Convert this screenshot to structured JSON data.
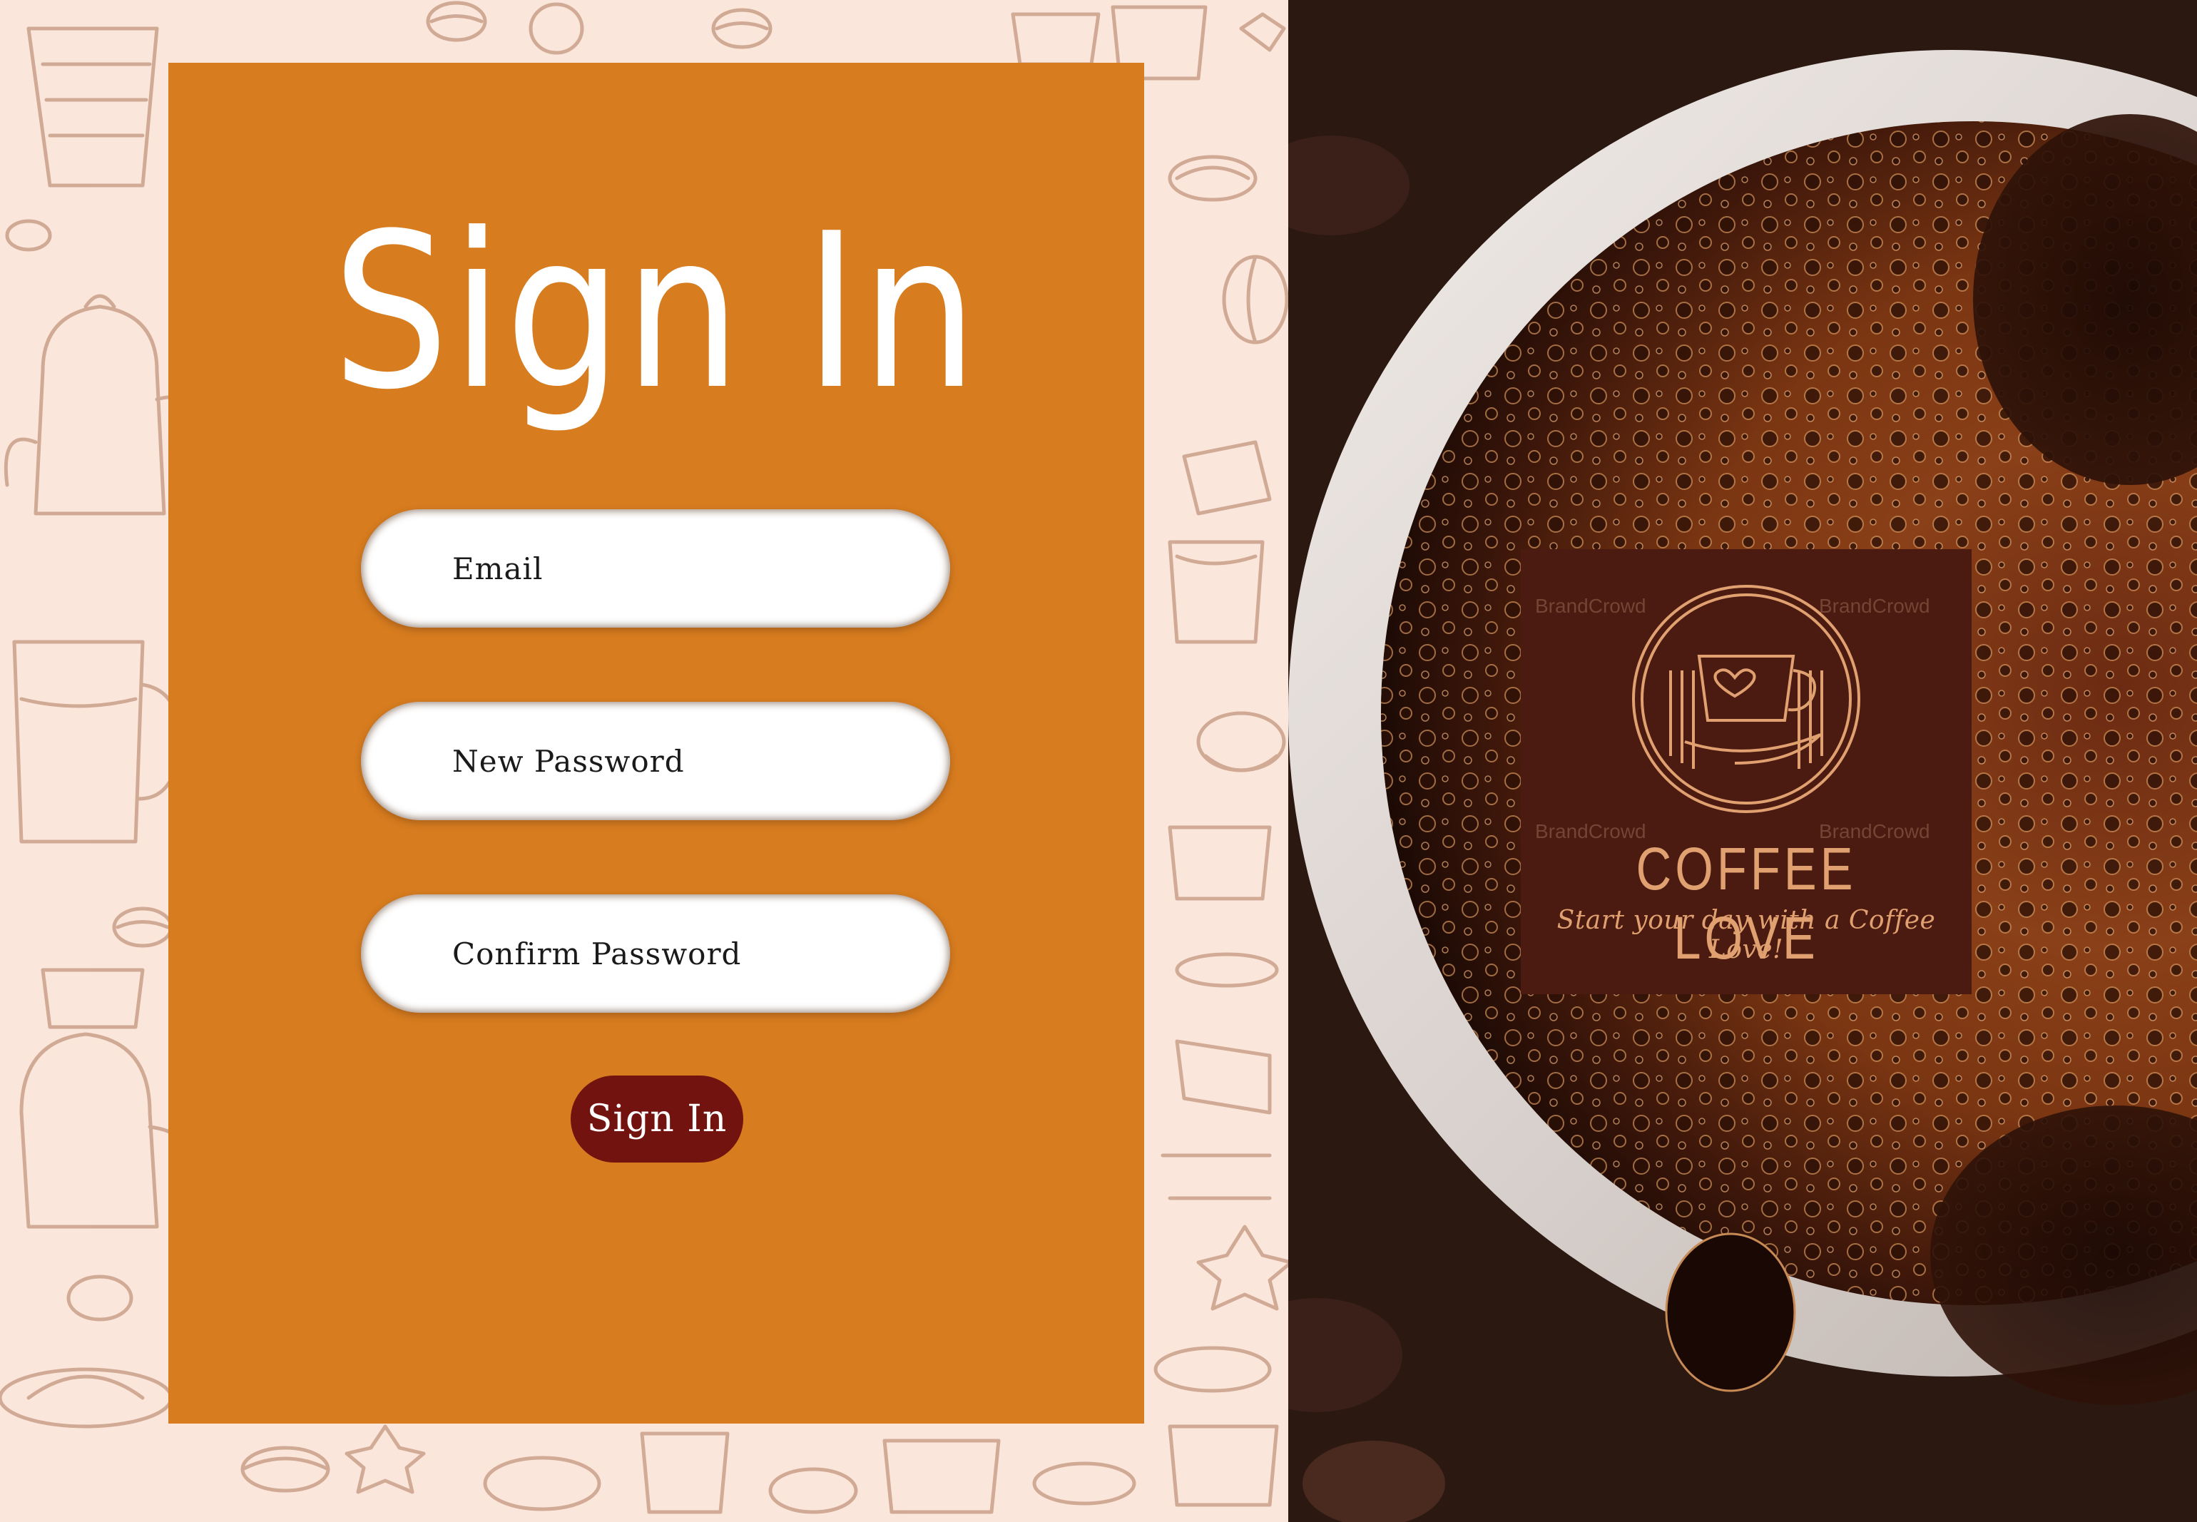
{
  "signin_form": {
    "title": "Sign In",
    "email_placeholder": "Email",
    "new_password_placeholder": "New Password",
    "confirm_password_placeholder": "Confirm Password",
    "submit_label": "Sign In"
  },
  "brand_logo": {
    "name": "COFFEE LOVE",
    "tagline": "Start your day with a Coffee Love!",
    "watermark": "BrandCrowd"
  },
  "colors": {
    "pattern_background": "#fbe6dc",
    "card_background": "#d77c1f",
    "button_background": "#72130f",
    "logo_background": "#4b1a10",
    "logo_text": "#e0a070"
  },
  "icons": {
    "logo_emblem": "coffee-cup-heart-icon",
    "background_pattern": "coffee-doodle-pattern",
    "photo": "coffee-cup-photo"
  }
}
